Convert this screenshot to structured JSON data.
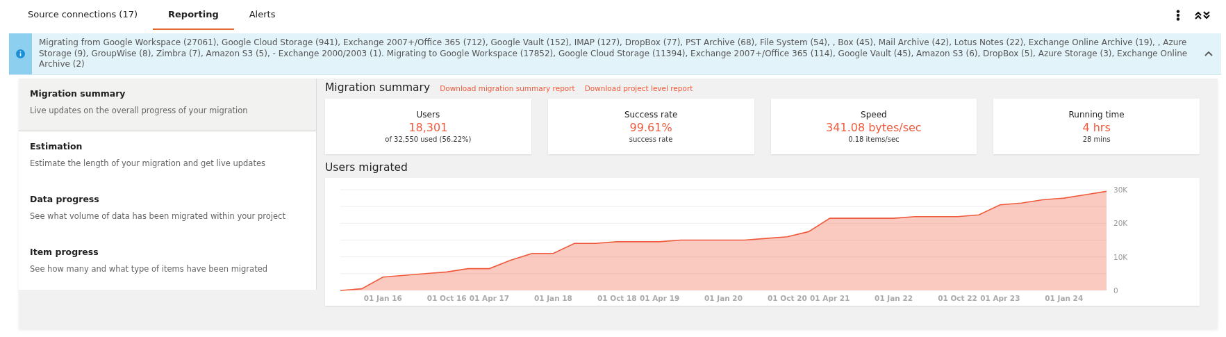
{
  "tabs": [
    {
      "label": "Source connections (17)",
      "selected": false
    },
    {
      "label": "Reporting",
      "selected": true
    },
    {
      "label": "Alerts",
      "selected": false
    }
  ],
  "banner": {
    "text": "Migrating from Google Workspace (27061), Google Cloud Storage (941), Exchange 2007+/Office 365 (712), Google Vault (152), IMAP (127), DropBox (77), PST Archive (68), File System (54), , Box (45), Mail Archive (42), Lotus Notes (22), Exchange Online Archive (19), , Azure Storage (9), GroupWise (8), Zimbra (7), Amazon S3 (5), - Exchange 2000/2003 (1). Migrating to Google Workspace (17852), Google Cloud Storage (11394), Exchange 2007+/Office 365 (114), Google Vault (45), Amazon S3 (6), DropBox (5), Azure Storage (3), Exchange Online Archive (2)",
    "expanded": true
  },
  "sidebar": {
    "items": [
      {
        "title": "Migration summary",
        "description": "Live updates on the overall progress of your migration",
        "selected": true
      },
      {
        "title": "Estimation",
        "description": "Estimate the length of your migration and get live updates",
        "selected": false
      },
      {
        "title": "Data progress",
        "description": "See what volume of data has been migrated within your project",
        "selected": false
      },
      {
        "title": "Item progress",
        "description": "See how many and what type of items have been migrated",
        "selected": false
      }
    ]
  },
  "summary": {
    "title": "Migration summary",
    "links": [
      "Download migration summary report",
      "Download project level report"
    ],
    "cards": [
      {
        "label": "Users",
        "value": "18,301",
        "sub": "of 32,550 used (56.22%)"
      },
      {
        "label": "Success rate",
        "value": "99.61%",
        "sub": "success rate"
      },
      {
        "label": "Speed",
        "value": "341.08 bytes/sec",
        "sub": "0.18 items/sec"
      },
      {
        "label": "Running time",
        "value": "4 hrs",
        "sub": "28 mins"
      }
    ]
  },
  "users_migrated": {
    "title": "Users migrated",
    "chart_data": {
      "type": "area",
      "categories": [
        null,
        null,
        "01 Jan 16",
        null,
        null,
        "01 Oct 16",
        null,
        "01 Apr 17",
        null,
        null,
        "01 Jan 18",
        null,
        null,
        "01 Oct 18",
        null,
        "01 Apr 19",
        null,
        null,
        "01 Jan 20",
        null,
        null,
        "01 Oct 20",
        null,
        "01 Apr 21",
        null,
        null,
        "01 Jan 22",
        null,
        null,
        "01 Oct 22",
        null,
        "01 Apr 23",
        null,
        null,
        "01 Jan 24",
        null,
        null
      ],
      "series": [
        {
          "color": "#f05a3c",
          "values": [
            0,
            500,
            4000,
            4500,
            5000,
            5500,
            6500,
            6500,
            9000,
            11000,
            11000,
            14000,
            14000,
            14500,
            14500,
            14500,
            15000,
            15000,
            15000,
            15000,
            15500,
            16000,
            17500,
            21500,
            21500,
            21500,
            21500,
            22000,
            22000,
            22000,
            22500,
            25500,
            26000,
            27000,
            27500,
            28500,
            29500
          ]
        }
      ],
      "grid": true,
      "ylim": [
        0,
        30000
      ],
      "yticks": [
        {
          "value": 0,
          "label": "0"
        },
        {
          "value": 10000,
          "label": "10K"
        },
        {
          "value": 20000,
          "label": "20K"
        },
        {
          "value": 30000,
          "label": "30K"
        }
      ]
    }
  }
}
